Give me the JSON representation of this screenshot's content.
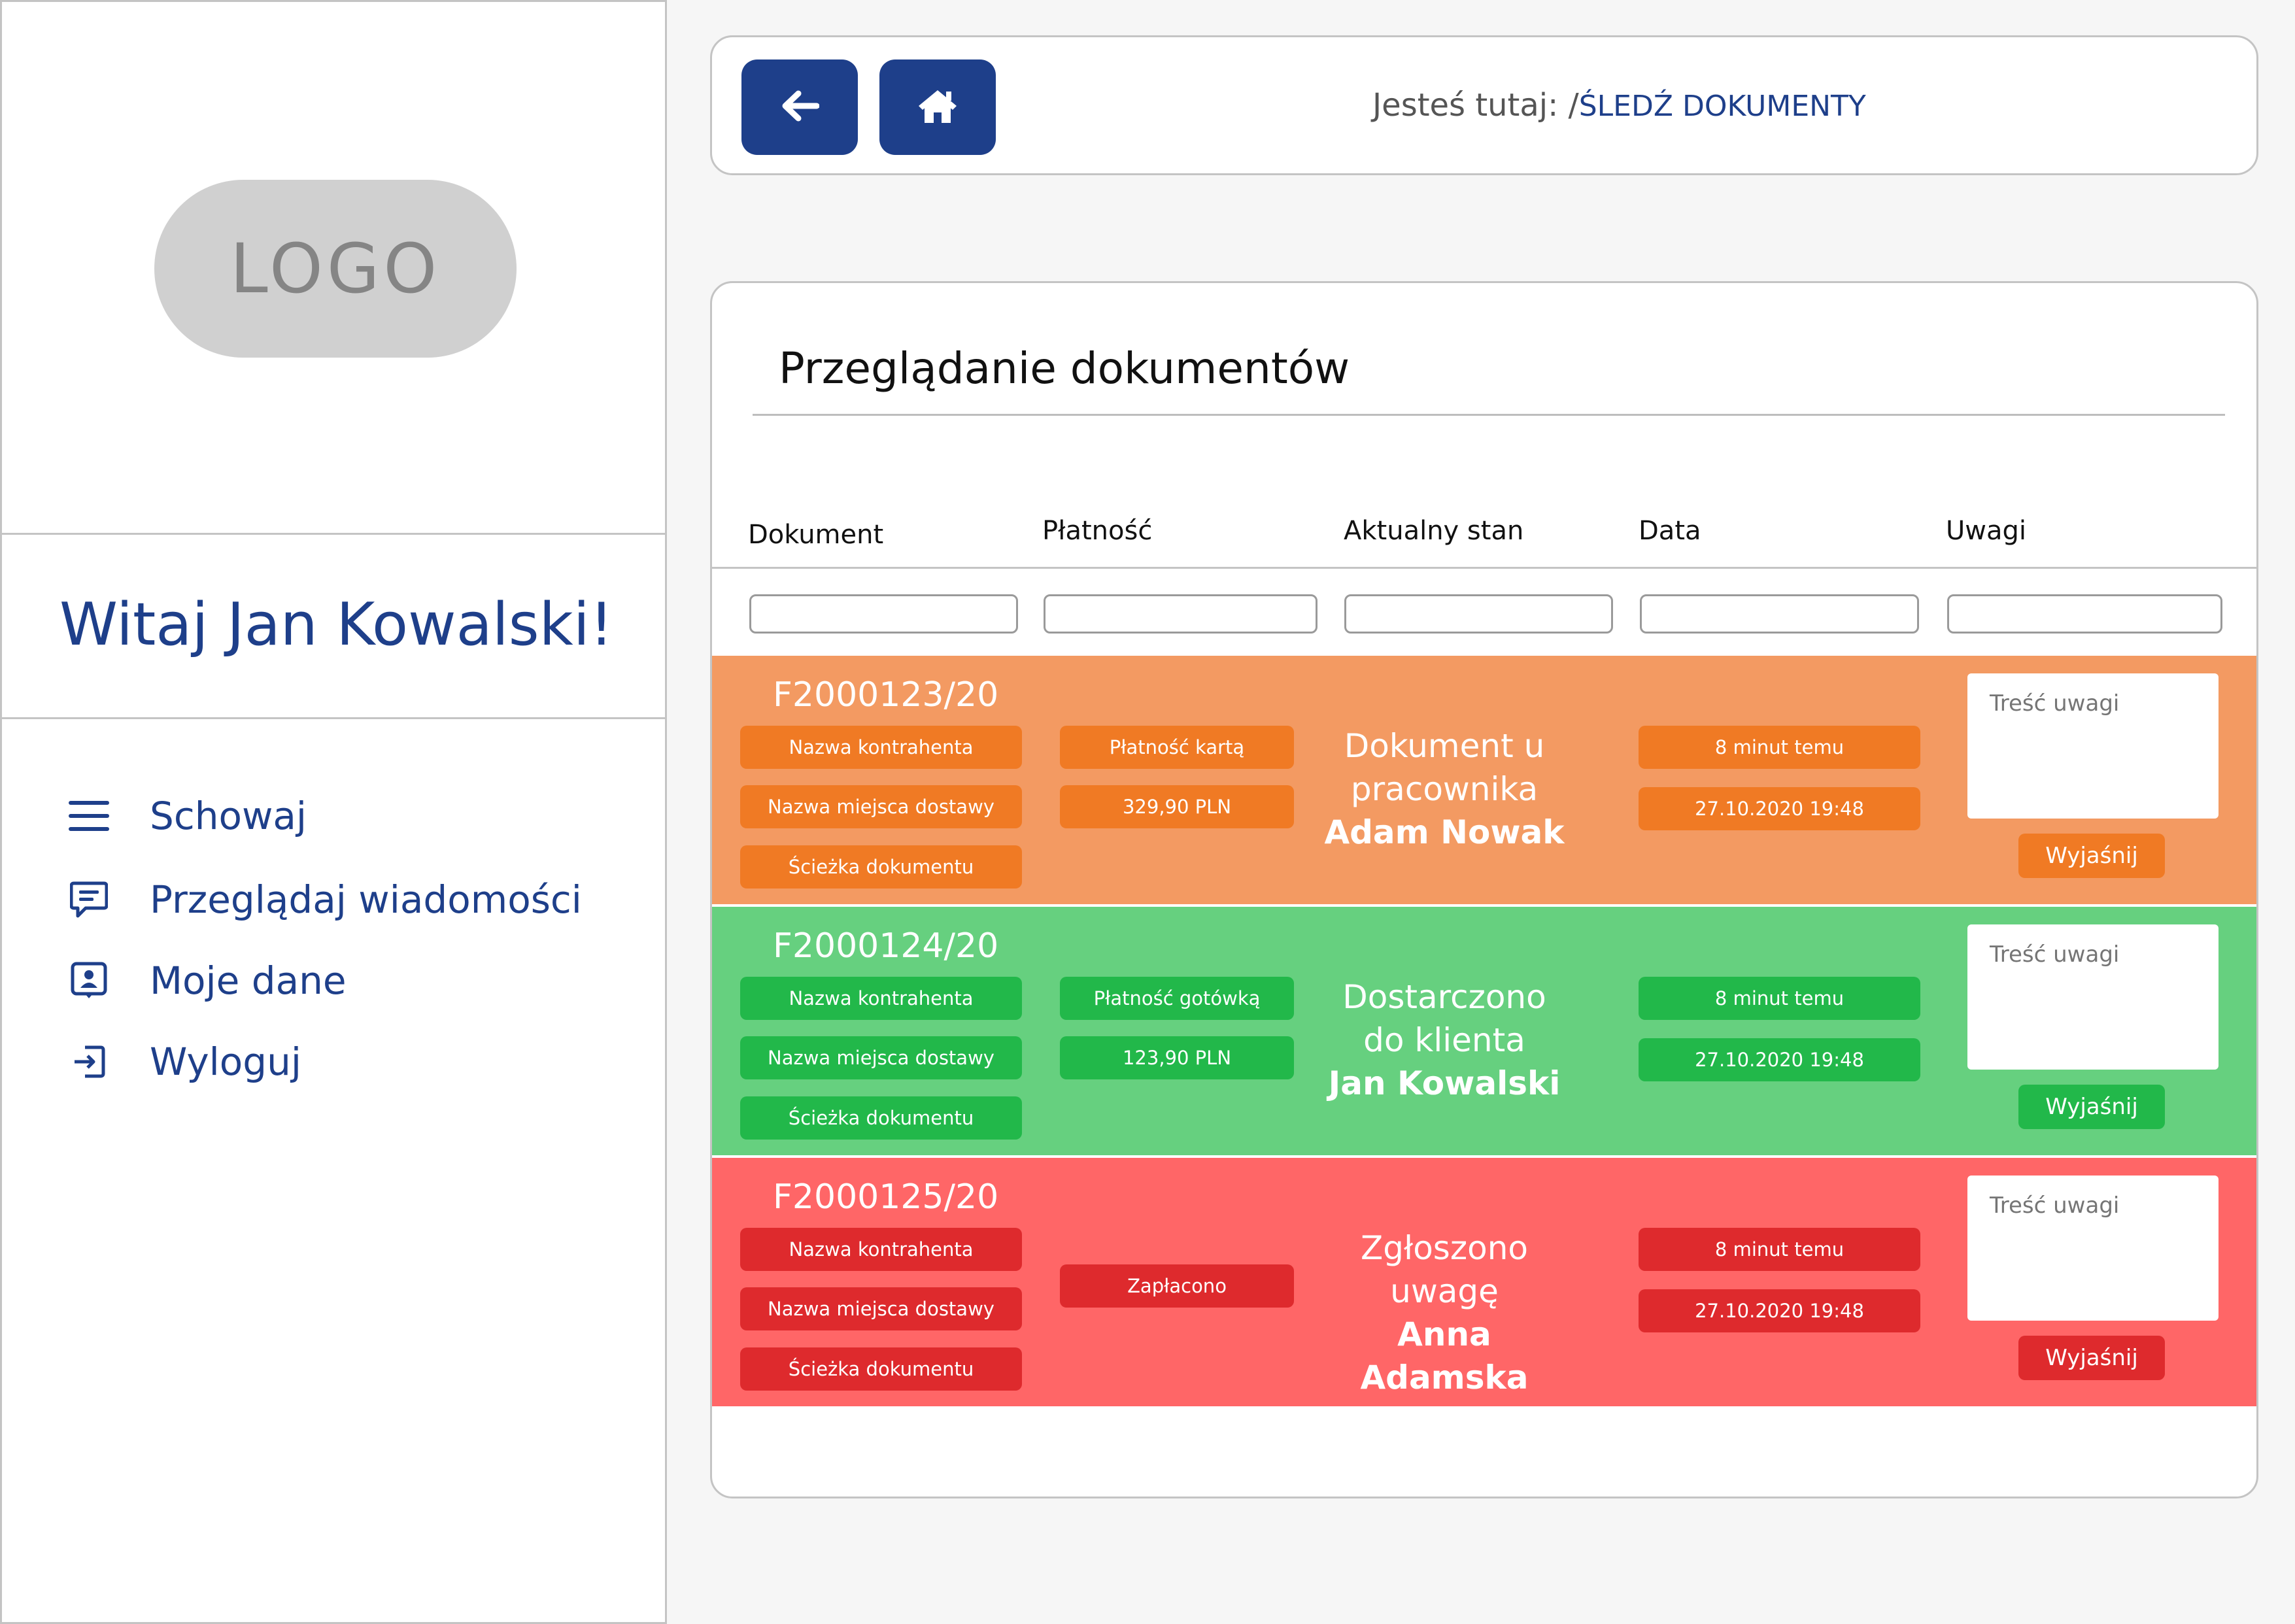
{
  "sidebar": {
    "logo_text": "LOGO",
    "welcome": "Witaj Jan Kowalski!",
    "items": [
      {
        "label": "Schowaj",
        "icon": "menu-icon"
      },
      {
        "label": "Przeglądaj wiadomości",
        "icon": "message-icon"
      },
      {
        "label": "Moje dane",
        "icon": "profile-icon"
      },
      {
        "label": "Wyloguj",
        "icon": "logout-icon"
      }
    ]
  },
  "header": {
    "back_icon": "arrow-left-icon",
    "home_icon": "home-icon",
    "breadcrumb_prefix": "Jesteś tutaj: /",
    "breadcrumb_current": "ŚLEDŹ DOKUMENTY"
  },
  "main": {
    "title": "Przeglądanie dokumentów",
    "columns": [
      "Dokument",
      "Płatność",
      "Aktualny stan",
      "Data",
      "Uwagi"
    ]
  },
  "rows": [
    {
      "id": "F2000123/20",
      "contractor": "Nazwa kontrahenta",
      "delivery": "Nazwa miejsca dostawy",
      "path": "Ścieżka dokumentu",
      "payment": [
        "Płatność kartą",
        "329,90 PLN"
      ],
      "status": [
        "Dokument u",
        "pracownika"
      ],
      "person": "Adam Nowak",
      "time_ago": "8 minut temu",
      "date": "27.10.2020 19:48",
      "note_placeholder": "Treść uwagi",
      "explain": "Wyjaśnij"
    },
    {
      "id": "F2000124/20",
      "contractor": "Nazwa kontrahenta",
      "delivery": "Nazwa miejsca dostawy",
      "path": "Ścieżka dokumentu",
      "payment": [
        "Płatność gotówką",
        "123,90 PLN"
      ],
      "status": [
        "Dostarczono",
        "do klienta"
      ],
      "person": "Jan Kowalski",
      "time_ago": "8 minut temu",
      "date": "27.10.2020 19:48",
      "note_placeholder": "Treść uwagi",
      "explain": "Wyjaśnij"
    },
    {
      "id": "F2000125/20",
      "contractor": "Nazwa kontrahenta",
      "delivery": "Nazwa miejsca dostawy",
      "path": "Ścieżka dokumentu",
      "payment": [
        "Zapłacono"
      ],
      "status": [
        "Zgłoszono",
        "uwagę"
      ],
      "person": "Anna Adamska",
      "time_ago": "8 minut temu",
      "date": "27.10.2020 19:48",
      "note_placeholder": "Treść uwagi",
      "explain": "Wyjaśnij"
    }
  ],
  "colors": {
    "brand": "#1e3f8a",
    "row_orange": "#f39a62",
    "pill_orange": "#f07a24",
    "row_green": "#66d07f",
    "pill_green": "#22b84a",
    "row_red": "#ff6667",
    "pill_red": "#de2a2d"
  }
}
